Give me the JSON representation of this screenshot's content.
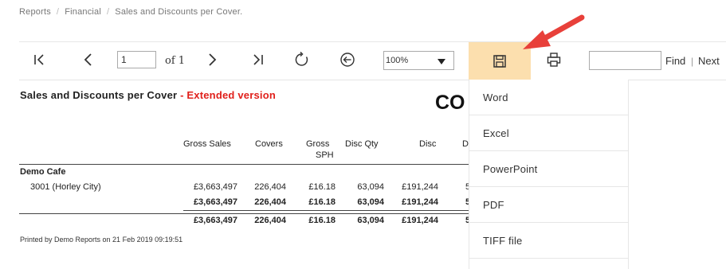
{
  "breadcrumb": [
    "Reports",
    "Financial",
    "Sales and Discounts per Cover."
  ],
  "toolbar": {
    "page_value": "1",
    "of_label": "of 1",
    "zoom_value": "100%",
    "find_label": "Find",
    "find_sep": "|",
    "next_label": "Next",
    "icons": [
      "first-page",
      "previous-page",
      "next-page",
      "last-page",
      "refresh",
      "back",
      "save",
      "print"
    ]
  },
  "report": {
    "title": "Sales and Discounts per Cover",
    "title_suffix": " - Extended version",
    "logo_partial": "CO",
    "columns": [
      "Gross Sales",
      "Covers",
      "Gross",
      "SPH",
      "Disc Qty",
      "Disc",
      "D"
    ],
    "group_name": "Demo Cafe",
    "row_label": "3001 (Horley City)",
    "rows": [
      {
        "gross_sales": "£3,663,497",
        "covers": "226,404",
        "sph": "£16.18",
        "disc_qty": "63,094",
        "disc": "£191,244",
        "extra": "5"
      },
      {
        "gross_sales": "£3,663,497",
        "covers": "226,404",
        "sph": "£16.18",
        "disc_qty": "63,094",
        "disc": "£191,244",
        "extra": "5"
      },
      {
        "gross_sales": "£3,663,497",
        "covers": "226,404",
        "sph": "£16.18",
        "disc_qty": "63,094",
        "disc": "£191,244",
        "extra": "5"
      }
    ],
    "printed_by": "Printed by Demo  Reports on 21 Feb 2019 09:19:51"
  },
  "export_menu": [
    "Word",
    "Excel",
    "PowerPoint",
    "PDF",
    "TIFF file"
  ],
  "colors": {
    "save_highlight": "#fcdfae",
    "arrow": "#e8403a",
    "extended_red": "#e0201b"
  }
}
